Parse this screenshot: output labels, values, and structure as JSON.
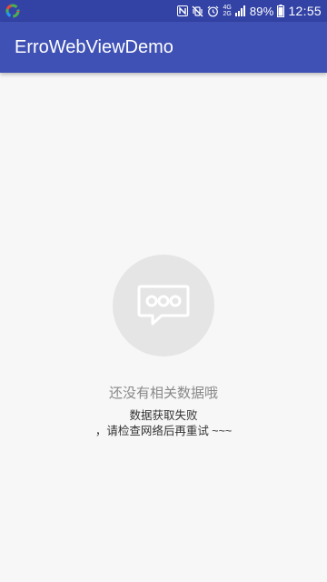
{
  "status_bar": {
    "left_icon": "app-notification-icon",
    "icons": [
      "nfc-icon",
      "vibrate-off-icon",
      "alarm-icon"
    ],
    "network_top": "4G",
    "network_bottom": "2G",
    "battery": "89%",
    "time": "12:55"
  },
  "app_bar": {
    "title": "ErroWebViewDemo"
  },
  "empty_state": {
    "icon": "chat-bubble-icon",
    "title": "还没有相关数据哦",
    "message": "数据获取失败\n，请检查网络后再重试 ~~~"
  },
  "colors": {
    "status_bar": "#3343a5",
    "app_bar": "#3f51b5",
    "background": "#f7f7f7",
    "circle": "#e5e5e5"
  }
}
